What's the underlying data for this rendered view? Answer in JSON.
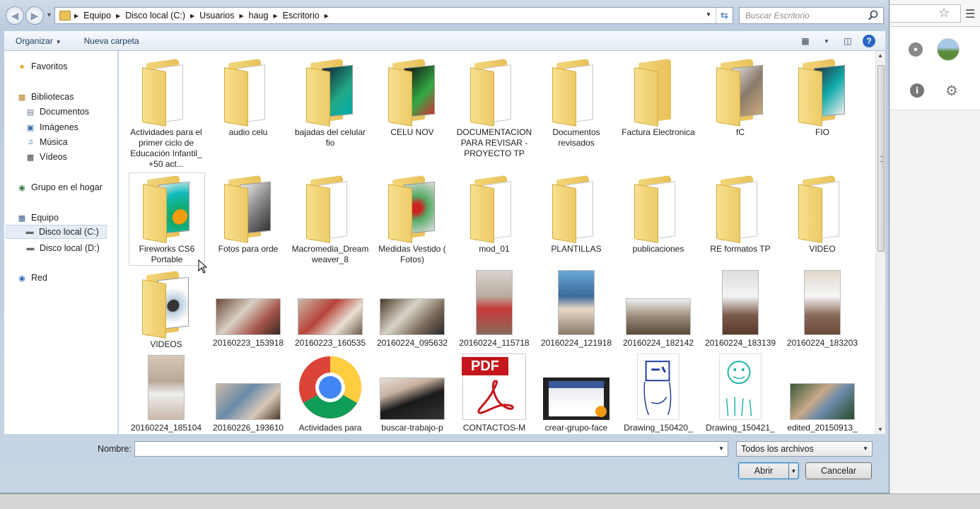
{
  "address": {
    "crumbs": [
      "Equipo",
      "Disco local (C:)",
      "Usuarios",
      "haug",
      "Escritorio"
    ]
  },
  "search": {
    "placeholder": "Buscar Escritorio"
  },
  "toolbar": {
    "organize": "Organizar",
    "new_folder": "Nueva carpeta"
  },
  "nav": {
    "favorites": "Favoritos",
    "libraries": "Bibliotecas",
    "documents": "Documentos",
    "images": "Imágenes",
    "music": "Música",
    "videos": "Vídeos",
    "homegroup": "Grupo en el hogar",
    "computer": "Equipo",
    "drive_c": "Disco local (C:)",
    "drive_d": "Disco local (D:)",
    "network": "Red"
  },
  "files": [
    {
      "name": "Actividades para el primer ciclo de Educación Infantil_ +50 act...",
      "kind": "folder"
    },
    {
      "name": "audio celu",
      "kind": "folder"
    },
    {
      "name": "bajadas del celular fio",
      "kind": "folder"
    },
    {
      "name": "CELU NOV",
      "kind": "folder"
    },
    {
      "name": "DOCUMENTACION PARA REVISAR - PROYECTO TP",
      "kind": "folder"
    },
    {
      "name": "Documentos revisados",
      "kind": "folder"
    },
    {
      "name": "Factura Electronica",
      "kind": "folder"
    },
    {
      "name": "fC",
      "kind": "folder"
    },
    {
      "name": "FIO",
      "kind": "folder"
    },
    {
      "name": "Fireworks CS6 Portable",
      "kind": "folder"
    },
    {
      "name": "Fotos para orde",
      "kind": "folder"
    },
    {
      "name": "Macromedia_Dreamweaver_8",
      "kind": "folder"
    },
    {
      "name": "Medidas Vestido ( Fotos)",
      "kind": "folder"
    },
    {
      "name": "mod_01",
      "kind": "folder"
    },
    {
      "name": "PLANTILLAS",
      "kind": "folder"
    },
    {
      "name": "publicaciones",
      "kind": "folder"
    },
    {
      "name": "RE formatos TP",
      "kind": "folder"
    },
    {
      "name": "VIDEO",
      "kind": "folder"
    },
    {
      "name": "VIDEOS",
      "kind": "folder"
    },
    {
      "name": "20160223_153918",
      "kind": "photo"
    },
    {
      "name": "20160223_160535",
      "kind": "photo"
    },
    {
      "name": "20160224_095632",
      "kind": "photo"
    },
    {
      "name": "20160224_115718",
      "kind": "photo-portrait"
    },
    {
      "name": "20160224_121918",
      "kind": "photo-portrait"
    },
    {
      "name": "20160224_182142",
      "kind": "photo"
    },
    {
      "name": "20160224_183139",
      "kind": "photo-portrait"
    },
    {
      "name": "20160224_183203",
      "kind": "photo-portrait"
    },
    {
      "name": "20160224_185104",
      "kind": "photo-portrait"
    },
    {
      "name": "20160226_193610",
      "kind": "photo"
    },
    {
      "name": "Actividades para",
      "kind": "chrome"
    },
    {
      "name": "buscar-trabajo-p",
      "kind": "photo"
    },
    {
      "name": "CONTACTOS-M",
      "kind": "pdf"
    },
    {
      "name": "crear-grupo-face",
      "kind": "video"
    },
    {
      "name": "Drawing_150420_",
      "kind": "drawing"
    },
    {
      "name": "Drawing_150421_",
      "kind": "drawing"
    },
    {
      "name": "edited_20150913_",
      "kind": "photo"
    }
  ],
  "pdf_badge": "PDF",
  "bottom": {
    "name_label": "Nombre:",
    "name_value": "",
    "filter": "Todos los archivos",
    "open": "Abrir",
    "cancel": "Cancelar"
  },
  "colors": {
    "folder": "#eccb68",
    "accent": "#2a66c4"
  }
}
